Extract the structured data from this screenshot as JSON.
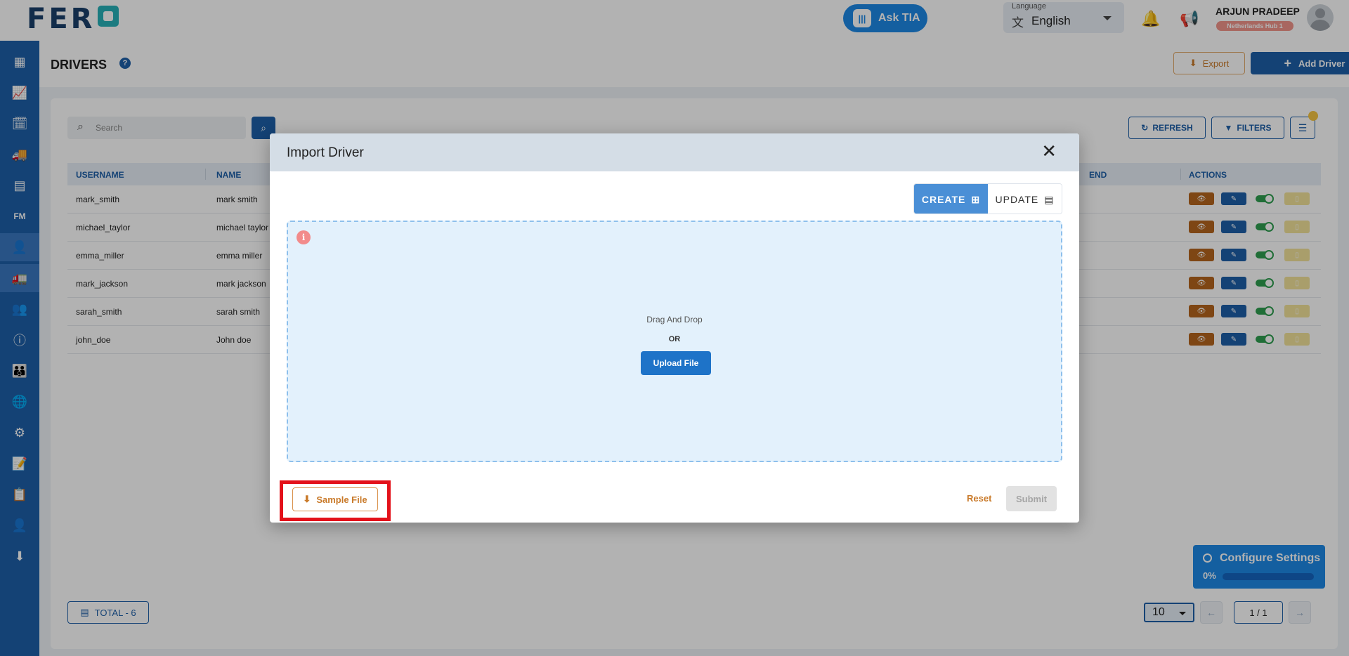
{
  "app": {
    "logo": "FER"
  },
  "topbar": {
    "ask_label": "Ask TIA",
    "ask_icon": "waveform-icon",
    "language_caption": "Language",
    "language_value": "English",
    "user_name": "ARJUN PRADEEP",
    "user_hub": "Netherlands Hub 1"
  },
  "sidebar": {
    "items": [
      {
        "name": "dashboard-icon",
        "glyph": "▦"
      },
      {
        "name": "chart-icon",
        "glyph": "📈"
      },
      {
        "name": "calendar-icon",
        "glyph": "🗓"
      },
      {
        "name": "truck-icon",
        "glyph": "🚚"
      },
      {
        "name": "archive-icon",
        "glyph": "▤"
      },
      {
        "name": "fm-label",
        "glyph": "FM"
      },
      {
        "name": "driver-icon",
        "glyph": "👤"
      },
      {
        "name": "vehicle-icon",
        "glyph": "🚛"
      },
      {
        "name": "users-icon",
        "glyph": "👥"
      },
      {
        "name": "info-icon",
        "glyph": "ⓘ"
      },
      {
        "name": "groups-icon",
        "glyph": "👪"
      },
      {
        "name": "globe-icon",
        "glyph": "🌐"
      },
      {
        "name": "gear-icon",
        "glyph": "⚙"
      },
      {
        "name": "edit-doc-icon",
        "glyph": "📝"
      },
      {
        "name": "clipboard-icon",
        "glyph": "📋"
      },
      {
        "name": "person-pin-icon",
        "glyph": "👤"
      },
      {
        "name": "download-icon",
        "glyph": "⬇"
      }
    ]
  },
  "page": {
    "title": "DRIVERS",
    "help": "?",
    "export_label": "Export",
    "add_label": "Add Driver"
  },
  "toolbar": {
    "search_placeholder": "Search",
    "refresh_label": "REFRESH",
    "filters_label": "FILTERS"
  },
  "table": {
    "headers": [
      "USERNAME",
      "NAME",
      "END",
      "ACTIONS"
    ],
    "rows": [
      {
        "username": "mark_smith",
        "name": "mark smith"
      },
      {
        "username": "michael_taylor",
        "name": "michael taylor"
      },
      {
        "username": "emma_miller",
        "name": "emma miller"
      },
      {
        "username": "mark_jackson",
        "name": "mark jackson"
      },
      {
        "username": "sarah_smith",
        "name": "sarah smith"
      },
      {
        "username": "john_doe",
        "name": "John doe"
      }
    ]
  },
  "footer": {
    "total_label": "TOTAL  - 6",
    "page_size": "10",
    "page_info": "1 / 1"
  },
  "modal": {
    "title": "Import Driver",
    "close": "✕",
    "create_label": "CREATE",
    "update_label": "UPDATE",
    "drag_drop": "Drag And Drop",
    "or": "OR",
    "upload_label": "Upload File",
    "sample_label": "Sample File",
    "reset_label": "Reset",
    "submit_label": "Submit"
  },
  "configure": {
    "title": "Configure Settings",
    "progress_text": "0%",
    "progress": 0
  },
  "colors": {
    "primary": "#1d5fa8",
    "accent_orange": "#c97a2a",
    "highlight_red": "#e3111a",
    "view_btn": "#b5651d",
    "edit_btn": "#1d5fa8",
    "toggle_on": "#2e9e4f"
  }
}
